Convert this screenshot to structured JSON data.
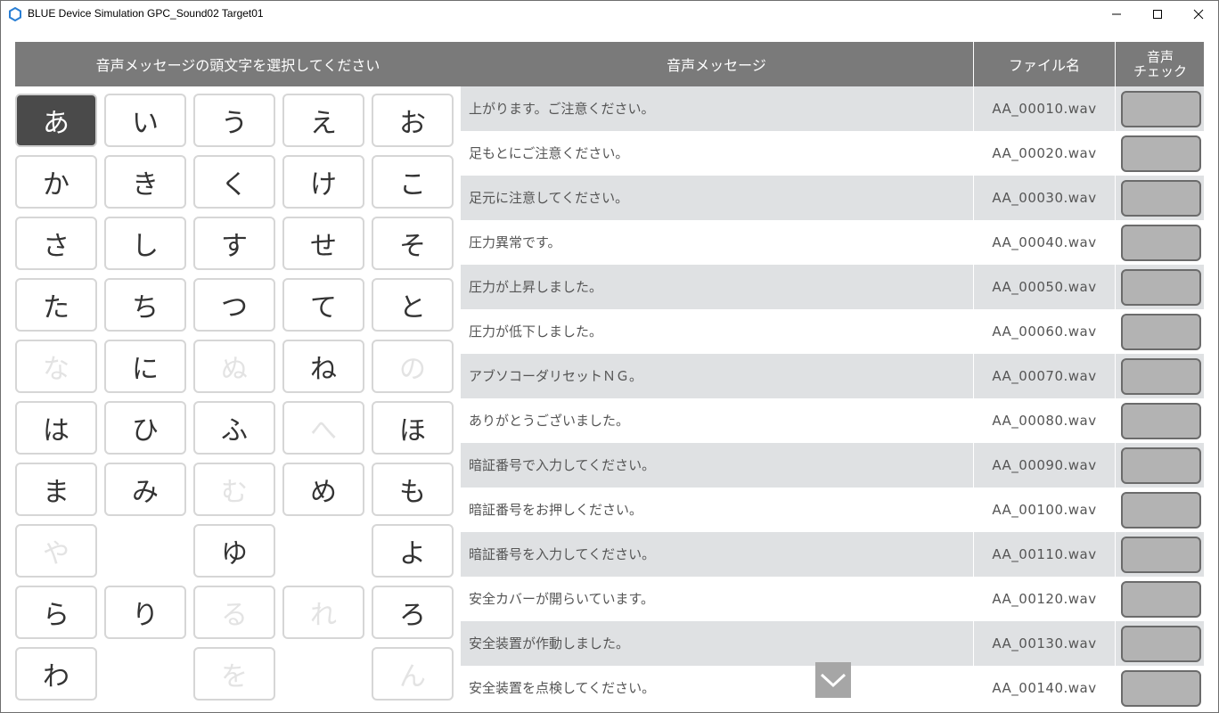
{
  "window": {
    "title": "BLUE Device Simulation GPC_Sound02 Target01"
  },
  "kana_panel": {
    "header": "音声メッセージの頭文字を選択してください",
    "selected": "あ",
    "rows": [
      [
        {
          "k": "あ",
          "s": "selected"
        },
        {
          "k": "い",
          "s": "enabled"
        },
        {
          "k": "う",
          "s": "enabled"
        },
        {
          "k": "え",
          "s": "enabled"
        },
        {
          "k": "お",
          "s": "enabled"
        }
      ],
      [
        {
          "k": "か",
          "s": "enabled"
        },
        {
          "k": "き",
          "s": "enabled"
        },
        {
          "k": "く",
          "s": "enabled"
        },
        {
          "k": "け",
          "s": "enabled"
        },
        {
          "k": "こ",
          "s": "enabled"
        }
      ],
      [
        {
          "k": "さ",
          "s": "enabled"
        },
        {
          "k": "し",
          "s": "enabled"
        },
        {
          "k": "す",
          "s": "enabled"
        },
        {
          "k": "せ",
          "s": "enabled"
        },
        {
          "k": "そ",
          "s": "enabled"
        }
      ],
      [
        {
          "k": "た",
          "s": "enabled"
        },
        {
          "k": "ち",
          "s": "enabled"
        },
        {
          "k": "つ",
          "s": "enabled"
        },
        {
          "k": "て",
          "s": "enabled"
        },
        {
          "k": "と",
          "s": "enabled"
        }
      ],
      [
        {
          "k": "な",
          "s": "disabled"
        },
        {
          "k": "に",
          "s": "enabled"
        },
        {
          "k": "ぬ",
          "s": "disabled"
        },
        {
          "k": "ね",
          "s": "enabled"
        },
        {
          "k": "の",
          "s": "disabled"
        }
      ],
      [
        {
          "k": "は",
          "s": "enabled"
        },
        {
          "k": "ひ",
          "s": "enabled"
        },
        {
          "k": "ふ",
          "s": "enabled"
        },
        {
          "k": "へ",
          "s": "disabled"
        },
        {
          "k": "ほ",
          "s": "enabled"
        }
      ],
      [
        {
          "k": "ま",
          "s": "enabled"
        },
        {
          "k": "み",
          "s": "enabled"
        },
        {
          "k": "む",
          "s": "disabled"
        },
        {
          "k": "め",
          "s": "enabled"
        },
        {
          "k": "も",
          "s": "enabled"
        }
      ],
      [
        {
          "k": "や",
          "s": "disabled"
        },
        null,
        {
          "k": "ゆ",
          "s": "enabled"
        },
        null,
        {
          "k": "よ",
          "s": "enabled"
        }
      ],
      [
        {
          "k": "ら",
          "s": "enabled"
        },
        {
          "k": "り",
          "s": "enabled"
        },
        {
          "k": "る",
          "s": "disabled"
        },
        {
          "k": "れ",
          "s": "disabled"
        },
        {
          "k": "ろ",
          "s": "enabled"
        }
      ],
      [
        {
          "k": "わ",
          "s": "enabled"
        },
        null,
        {
          "k": "を",
          "s": "disabled"
        },
        null,
        {
          "k": "ん",
          "s": "disabled"
        }
      ]
    ]
  },
  "table": {
    "headers": {
      "message": "音声メッセージ",
      "file": "ファイル名",
      "check_line1": "音声",
      "check_line2": "チェック"
    },
    "rows": [
      {
        "message": "上がります。ご注意ください。",
        "file": "AA_00010.wav"
      },
      {
        "message": "足もとにご注意ください。",
        "file": "AA_00020.wav"
      },
      {
        "message": "足元に注意してください。",
        "file": "AA_00030.wav"
      },
      {
        "message": "圧力異常です。",
        "file": "AA_00040.wav"
      },
      {
        "message": "圧力が上昇しました。",
        "file": "AA_00050.wav"
      },
      {
        "message": "圧力が低下しました。",
        "file": "AA_00060.wav"
      },
      {
        "message": "アブソコーダリセットＮＧ。",
        "file": "AA_00070.wav"
      },
      {
        "message": "ありがとうございました。",
        "file": "AA_00080.wav"
      },
      {
        "message": "暗証番号で入力してください。",
        "file": "AA_00090.wav"
      },
      {
        "message": "暗証番号をお押しください。",
        "file": "AA_00100.wav"
      },
      {
        "message": "暗証番号を入力してください。",
        "file": "AA_00110.wav"
      },
      {
        "message": "安全カバーが開らいています。",
        "file": "AA_00120.wav"
      },
      {
        "message": "安全装置が作動しました。",
        "file": "AA_00130.wav"
      },
      {
        "message": "安全装置を点検してください。",
        "file": "AA_00140.wav"
      }
    ]
  },
  "icons": {
    "app": "hexagon-icon",
    "minimize": "minimize-icon",
    "maximize": "maximize-icon",
    "close": "close-icon",
    "scroll": "chevron-down-icon"
  },
  "colors": {
    "header_bg": "#7a7a7a",
    "selected_kana_bg": "#4a4a4a",
    "row_alt": "#dfe1e3",
    "check_button": "#b3b3b3",
    "app_icon": "#2a7fd4"
  }
}
